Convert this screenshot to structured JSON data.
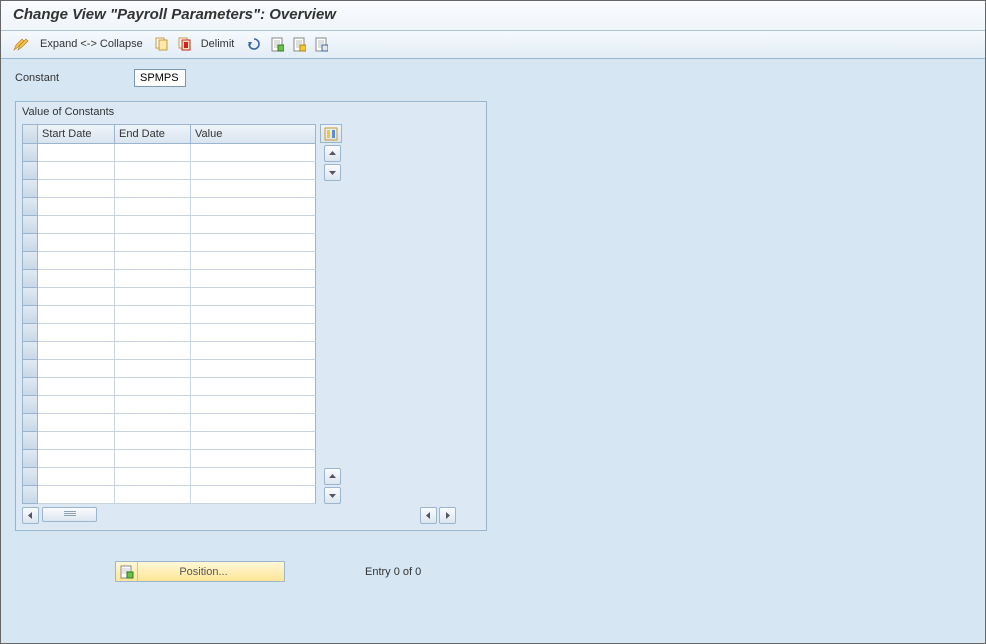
{
  "header": {
    "title": "Change View \"Payroll Parameters\": Overview"
  },
  "toolbar": {
    "expand_collapse": "Expand <-> Collapse",
    "delimit": "Delimit"
  },
  "form": {
    "constant_label": "Constant",
    "constant_value": "SPMPS"
  },
  "groupbox": {
    "title": "Value of Constants",
    "columns": {
      "start_date": "Start Date",
      "end_date": "End Date",
      "value": "Value"
    }
  },
  "footer": {
    "position_btn": "Position...",
    "entry_text": "Entry 0 of 0"
  }
}
